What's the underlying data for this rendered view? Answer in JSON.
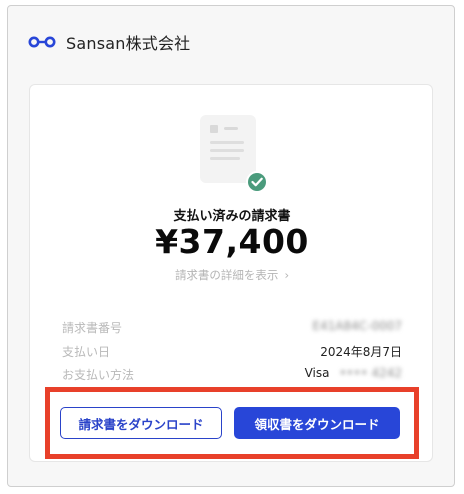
{
  "header": {
    "company_name": "Sansan株式会社",
    "logo_icon": "sansan-logo-icon"
  },
  "receipt": {
    "status_label": "支払い済みの請求書",
    "amount": "¥37,400",
    "detail_link": "請求書の詳細を表示",
    "illustration_icon": "paid-document-check-icon"
  },
  "details": [
    {
      "key": "請求書番号",
      "value": "E41A84C-0007"
    },
    {
      "key": "支払い日",
      "value": "2024年8月7日"
    },
    {
      "key": "お支払い方法",
      "brand": "Visa",
      "masked": "•••• 4242"
    }
  ],
  "actions": {
    "download_invoice": "請求書をダウンロード",
    "download_receipt": "領収書をダウンロード"
  },
  "colors": {
    "primary": "#2846d8",
    "highlight": "#e8402a",
    "check": "#4a9b7c"
  }
}
